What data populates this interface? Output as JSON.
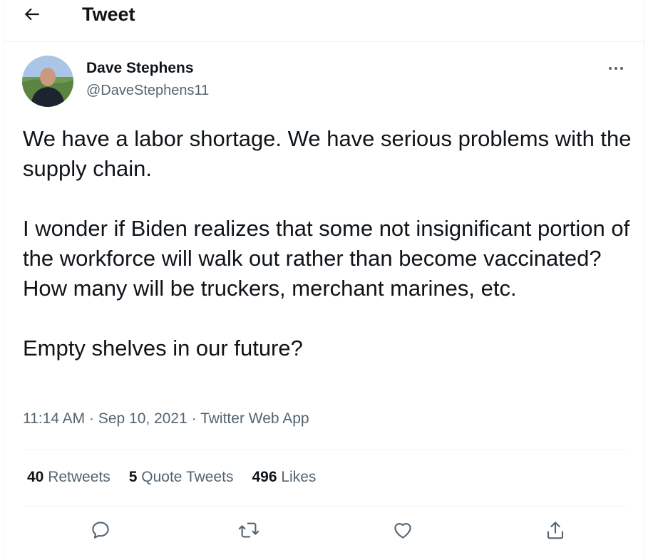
{
  "header": {
    "title": "Tweet",
    "back_icon": "arrow-left-icon"
  },
  "author": {
    "name": "Dave Stephens",
    "handle": "@DaveStephens11"
  },
  "tweet": {
    "paragraphs": [
      "We have a labor shortage. We have serious problems with the supply chain.",
      "I wonder if Biden realizes that some not insignificant portion of the workforce will walk out rather than become vaccinated? How many will be truckers, merchant marines, etc.",
      "Empty shelves in our future?"
    ],
    "time": "11:14 AM",
    "separator": " · ",
    "date": "Sep 10, 2021",
    "source": "Twitter Web App"
  },
  "stats": {
    "retweets": {
      "count": "40",
      "label": "Retweets"
    },
    "quotes": {
      "count": "5",
      "label": "Quote Tweets"
    },
    "likes": {
      "count": "496",
      "label": "Likes"
    }
  },
  "actions": [
    "reply-icon",
    "retweet-icon",
    "like-icon",
    "share-icon"
  ],
  "colors": {
    "text": "#0f1419",
    "secondary": "#536471",
    "divider": "#eff3f4"
  }
}
